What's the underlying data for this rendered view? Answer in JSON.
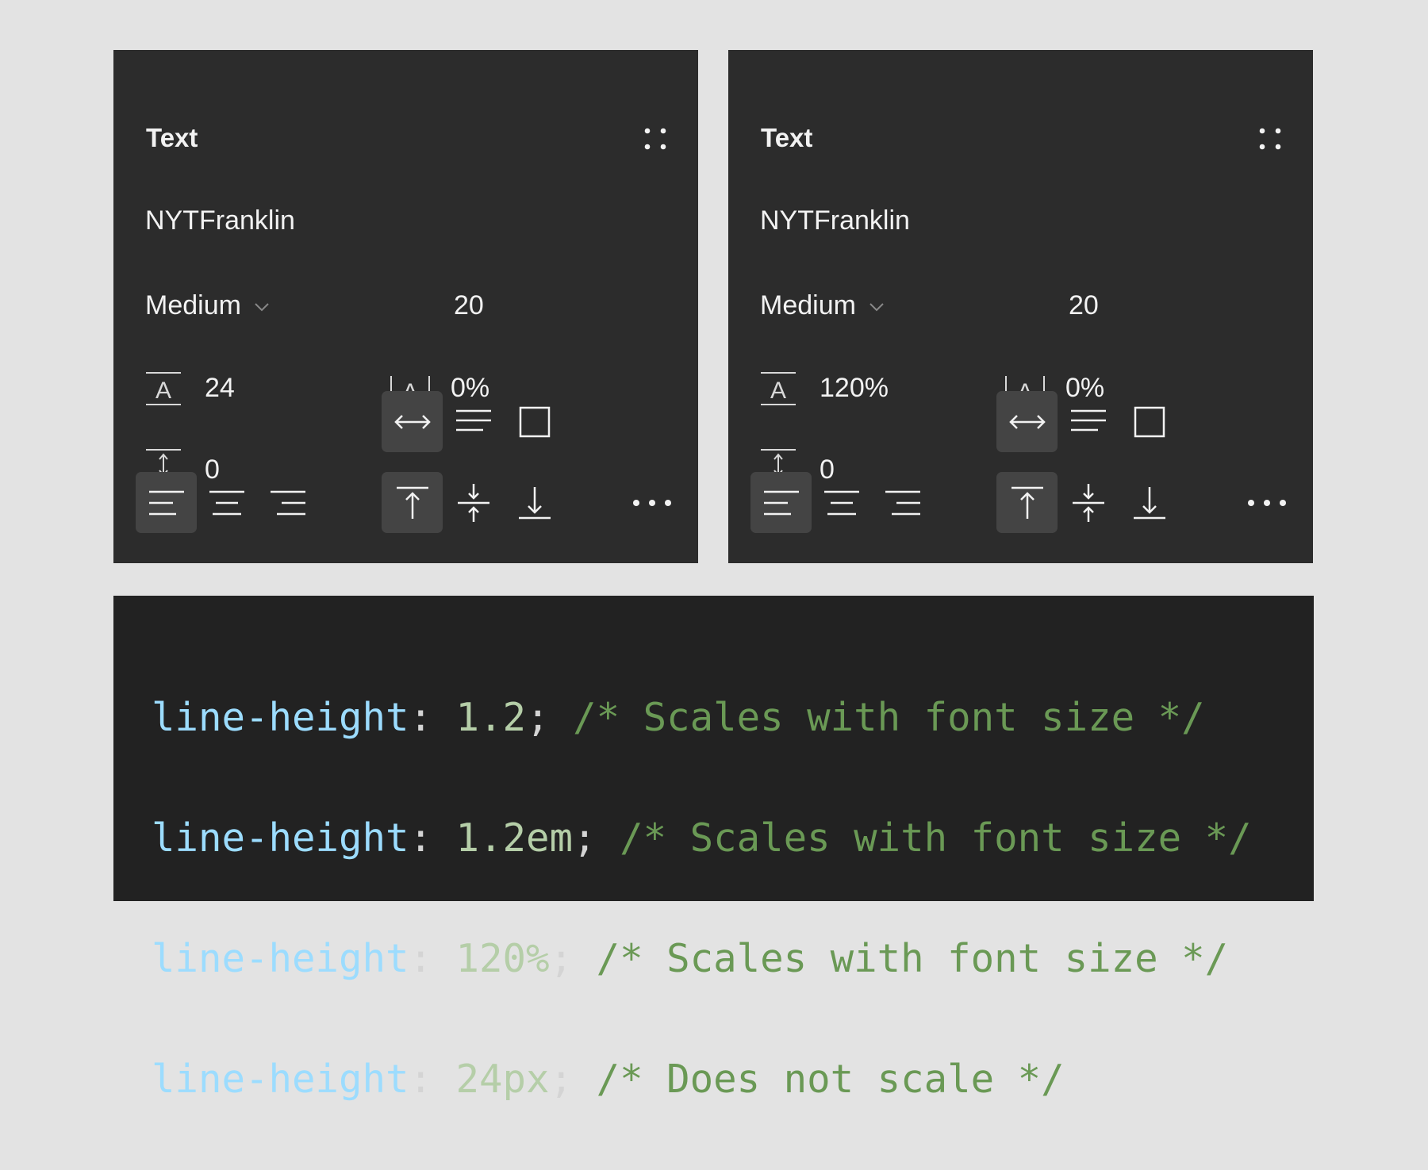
{
  "panels": [
    {
      "title": "Text",
      "font_name": "NYTFranklin",
      "weight": "Medium",
      "size": "20",
      "line_height": "24",
      "letter_spacing": "0%",
      "paragraph_spacing": "0"
    },
    {
      "title": "Text",
      "font_name": "NYTFranklin",
      "weight": "Medium",
      "size": "20",
      "line_height": "120%",
      "letter_spacing": "0%",
      "paragraph_spacing": "0"
    }
  ],
  "code": {
    "lines": [
      {
        "prop": "line-height",
        "colon": ":",
        "value": "1.2",
        "semi": ";",
        "comment": "/* Scales with font size */"
      },
      {
        "prop": "line-height",
        "colon": ":",
        "value": "1.2em",
        "semi": ";",
        "comment": "/* Scales with font size */"
      },
      {
        "prop": "line-height",
        "colon": ":",
        "value": "120%",
        "semi": ";",
        "comment": "/* Scales with font size */"
      },
      {
        "prop": "line-height",
        "colon": ":",
        "value": "24px",
        "semi": ";",
        "comment": "/* Does not scale */"
      }
    ]
  },
  "icons": {
    "title_menu": "four-dots-icon",
    "weight_dropdown": "chevron-down-icon",
    "line_height": "line-height-icon",
    "letter_spacing": "letter-spacing-icon",
    "paragraph_spacing": "paragraph-spacing-icon",
    "auto_width": "auto-width-icon",
    "auto_height": "auto-height-icon",
    "fixed_size": "fixed-size-icon",
    "align_left": "align-left-icon",
    "align_center": "align-center-icon",
    "align_right": "align-right-icon",
    "align_top": "align-top-icon",
    "align_middle": "align-middle-icon",
    "align_bottom": "align-bottom-icon",
    "more": "more-icon"
  },
  "colors": {
    "page_bg": "#e3e3e3",
    "panel_bg": "#2c2c2c",
    "active_button_bg": "#444444",
    "code_bg": "#222222",
    "code_property": "#9cdcfe",
    "code_value": "#b5cea8",
    "code_comment": "#6a9955"
  }
}
